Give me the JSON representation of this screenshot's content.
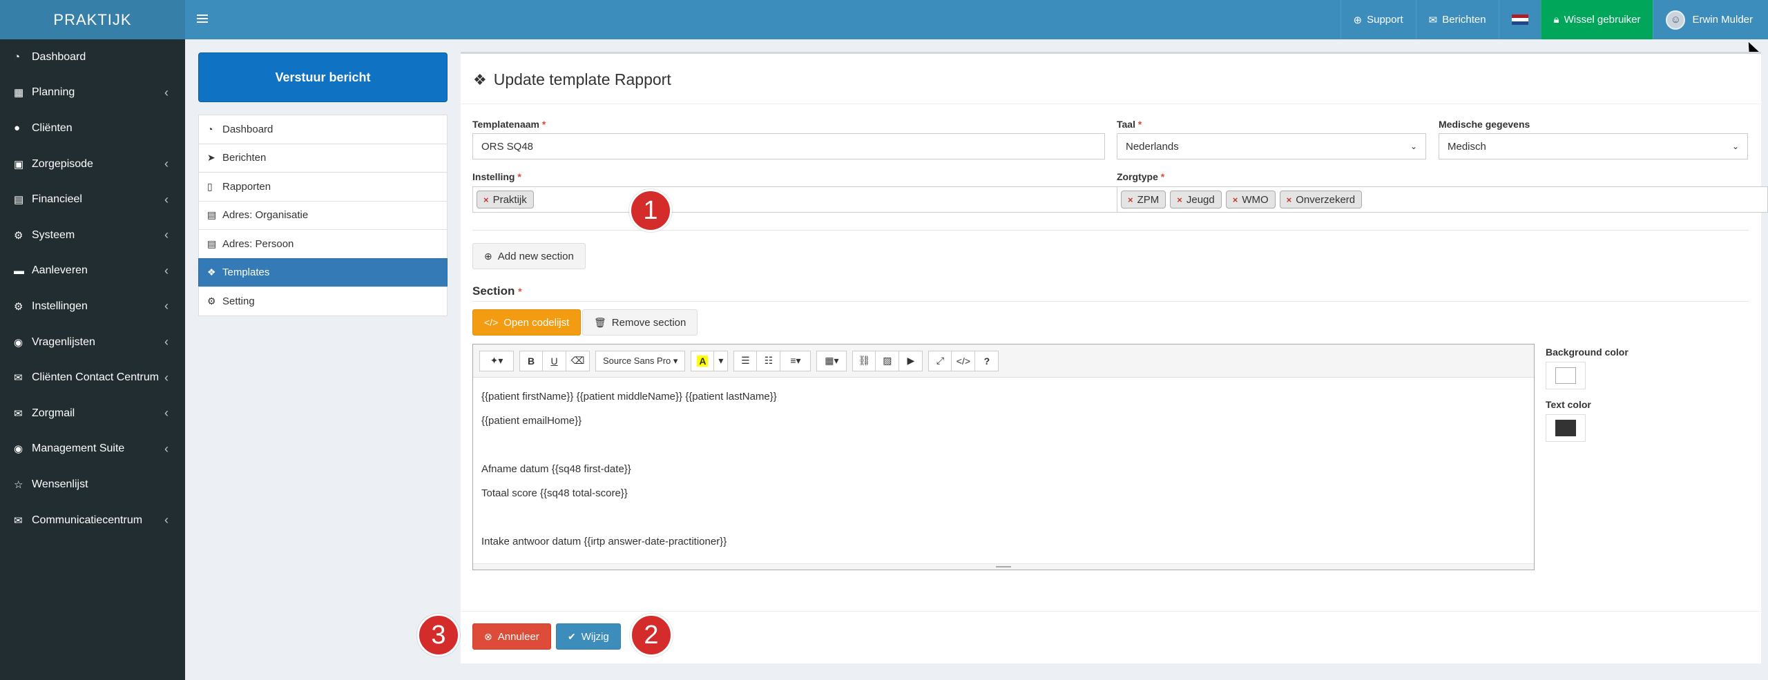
{
  "app": {
    "logo": "PRAKTIJK"
  },
  "topnav": {
    "support": "Support",
    "berichten": "Berichten",
    "wissel": "Wissel gebruiker",
    "user": "Erwin Mulder"
  },
  "sidebar": {
    "items": [
      {
        "label": "Dashboard",
        "icon": "dashboard-icon"
      },
      {
        "label": "Planning",
        "icon": "calendar-icon"
      },
      {
        "label": "Cliënten",
        "icon": "user-icon"
      },
      {
        "label": "Zorgepisode",
        "icon": "medkit-icon"
      },
      {
        "label": "Financieel",
        "icon": "book-icon"
      },
      {
        "label": "Systeem",
        "icon": "cogs-icon"
      },
      {
        "label": "Aanleveren",
        "icon": "truck-icon"
      },
      {
        "label": "Instellingen",
        "icon": "gear-icon"
      },
      {
        "label": "Vragenlijsten",
        "icon": "globe-icon"
      },
      {
        "label": "Cliënten Contact Centrum",
        "icon": "envelope-icon"
      },
      {
        "label": "Zorgmail",
        "icon": "envelope-icon"
      },
      {
        "label": "Management Suite",
        "icon": "globe-icon"
      },
      {
        "label": "Wensenlijst",
        "icon": "star-icon"
      },
      {
        "label": "Communicatiecentrum",
        "icon": "envelope-icon"
      }
    ]
  },
  "secondary": {
    "send_label": "Verstuur bericht",
    "items": [
      {
        "label": "Dashboard"
      },
      {
        "label": "Berichten"
      },
      {
        "label": "Rapporten"
      },
      {
        "label": "Adres: Organisatie"
      },
      {
        "label": "Adres: Persoon"
      },
      {
        "label": "Templates"
      },
      {
        "label": "Setting"
      }
    ]
  },
  "form": {
    "title": "Update template Rapport",
    "templatenaam_label": "Templatenaam",
    "templatenaam_value": "ORS SQ48",
    "taal_label": "Taal",
    "taal_value": "Nederlands",
    "medisch_label": "Medische gegevens",
    "medisch_value": "Medisch",
    "instelling_label": "Instelling",
    "instelling_tags": [
      "Praktijk"
    ],
    "zorgtype_label": "Zorgtype",
    "zorgtype_tags": [
      "ZPM",
      "Jeugd",
      "WMO",
      "Onverzekerd"
    ],
    "add_section": "Add new section",
    "section_label": "Section",
    "open_codelijst": "Open codelijst",
    "remove_section": "Remove section",
    "font_name": "Source Sans Pro",
    "editor_lines": [
      "{{patient firstName}} {{patient middleName}} {{patient lastName}}",
      "{{patient emailHome}}",
      "",
      "Afname datum {{sq48 first-date}}",
      "Totaal score {{sq48 total-score}}",
      "",
      "Intake antwoor datum {{irtp answer-date-practitioner}}"
    ],
    "bg_color_label": "Background color",
    "text_color_label": "Text color",
    "cancel": "Annuleer",
    "submit": "Wijzig"
  },
  "markers": [
    "1",
    "2",
    "3"
  ],
  "colors": {
    "header": "#3c8dbc",
    "sidebar": "#222d32",
    "active": "#337ab7",
    "send_button": "#0f72c2",
    "wissel": "#00a65a",
    "marker": "#d42b2b",
    "bg_swatch": "#ffffff",
    "text_swatch": "#333333"
  }
}
